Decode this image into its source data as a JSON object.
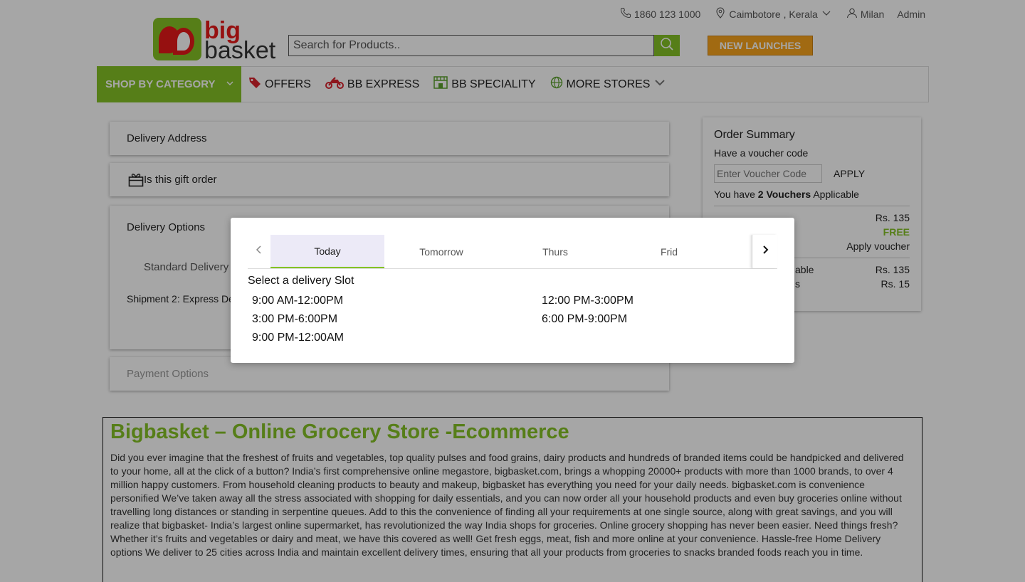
{
  "topbar": {
    "phone": "1860 123 1000",
    "location": "Caimbotore , Kerala",
    "user_first": "Milan",
    "user_last": "Admin"
  },
  "brand": {
    "line1": "big",
    "line2": "basket"
  },
  "search": {
    "placeholder": "Search for Products.."
  },
  "new_launches": "NEW LAUNCHES",
  "nav": {
    "category": "SHOP BY CATEGORY",
    "offers": "OFFERS",
    "express": "BB EXPRESS",
    "speciality": "BB SPECIALITY",
    "more": "MORE STORES"
  },
  "panels": {
    "delivery_address": "Delivery Address",
    "gift_order": "Is this gift order",
    "delivery_options": "Delivery Options",
    "standard": "Standard Delivery",
    "shipment": "Shipment 2: Express De",
    "payment": "Payment Options"
  },
  "summary": {
    "title": "Order Summary",
    "voucher_prompt": "Have a voucher code",
    "voucher_placeholder": "Enter Voucher Code",
    "apply": "APPLY",
    "vouchers_pre": "You have ",
    "vouchers_count": "2 Vouchers",
    "vouchers_post": " Applicable",
    "line1_value": "Rs. 135",
    "line2_value": "FREE",
    "line3_value": "Apply voucher",
    "line4_label": "able",
    "line4_value": "Rs. 135",
    "line5_label": "s",
    "line5_value": "Rs. 15"
  },
  "seo": {
    "title": "Bigbasket – Online Grocery Store -Ecommerce",
    "body": "Did you ever imagine that the freshest of fruits and vegetables, top quality pulses and food grains, dairy products and hundreds of branded items could be handpicked and delivered to your home, all at the click of a button? India’s first comprehensive online megastore, bigbasket.com, brings a whopping 20000+ products with more than 1000 brands, to over 4 million happy customers. From household cleaning products to beauty and makeup, bigbasket has everything you need for your daily needs. bigbasket.com is convenience personified We’ve taken away all the stress associated with shopping for daily essentials, and you can now order all your household products and even buy groceries online without travelling long distances or standing in serpentine queues. Add to this the convenience of finding all your requirements at one single source, along with great savings, and you will realize that bigbasket- India’s largest online supermarket, has revolutionized the way India shops for groceries. Online grocery shopping has never been easier. Need things fresh? Whether it’s fruits and vegetables or dairy and meat, we have this covered as well! Get fresh eggs, meat, fish and more online at your convenience. Hassle-free Home Delivery options We deliver to 25 cities across India and maintain excellent delivery times, ensuring that all your products from groceries to snacks branded foods reach you in time."
  },
  "modal": {
    "tabs": [
      "Today",
      "Tomorrow",
      "Thurs",
      "Frid"
    ],
    "heading": "Select a delivery Slot",
    "slots": [
      "9:00 AM-12:00PM",
      "12:00 PM-3:00PM",
      "3:00 PM-6:00PM",
      "6:00 PM-9:00PM",
      "9:00 PM-12:00AM"
    ]
  },
  "colors": {
    "brand_green": "#84c225",
    "brand_red": "#e61a1a",
    "launch_orange": "#f7a41d"
  }
}
